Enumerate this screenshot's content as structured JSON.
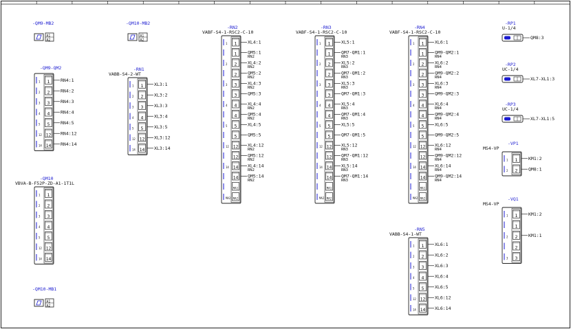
{
  "frame": {
    "ruler_count": 16
  },
  "colors": {
    "tag": "#1a1ad0",
    "line": "#222222",
    "rail": "#1a1ad0",
    "cap": "#c8c8c8"
  },
  "devices": [
    {
      "id": "qm9-mb2",
      "kind": "coil",
      "tag": "-QM9-MB2",
      "subtitle": "",
      "pins": [
        "A1",
        "A2"
      ]
    },
    {
      "id": "qm10-mb2",
      "kind": "coil",
      "tag": "-QM10-MB2",
      "subtitle": "",
      "pins": [
        "A1",
        "A2"
      ]
    },
    {
      "id": "qm10-mb1",
      "kind": "coil",
      "tag": "-QM10-MB1",
      "subtitle": "",
      "pins": [
        "A1",
        "A2"
      ]
    },
    {
      "id": "qm9-qm2",
      "kind": "strip",
      "tag": "-QM9-QM2",
      "subtitle": "",
      "rows": [
        {
          "pin": "1",
          "left": "1",
          "right": [
            "RN4:1"
          ]
        },
        {
          "pin": "2",
          "left": "2",
          "right": [
            "RN4:2"
          ]
        },
        {
          "pin": "3",
          "left": "3",
          "right": [
            "RN4:3"
          ]
        },
        {
          "pin": "4",
          "left": "4",
          "right": [
            "RN4:4"
          ]
        },
        {
          "pin": "5",
          "left": "5",
          "right": [
            "RN4:5"
          ]
        },
        {
          "pin": "12",
          "left": "12",
          "right": [
            "RN4:12"
          ]
        },
        {
          "pin": "14",
          "left": "14",
          "right": [
            "RN4:14"
          ]
        }
      ]
    },
    {
      "id": "qm10",
      "kind": "strip",
      "tag": "-QM10",
      "subtitle": "VBVA-B-F52P-ZD-A1-1T1L",
      "rows": [
        {
          "pin": "1",
          "left": "1",
          "right": []
        },
        {
          "pin": "2",
          "left": "2",
          "right": []
        },
        {
          "pin": "3",
          "left": "3",
          "right": []
        },
        {
          "pin": "4",
          "left": "4",
          "right": []
        },
        {
          "pin": "5",
          "left": "5",
          "right": []
        },
        {
          "pin": "12",
          "left": "12",
          "right": []
        },
        {
          "pin": "14",
          "left": "14",
          "right": []
        }
      ]
    },
    {
      "id": "rn1",
      "kind": "strip",
      "tag": "-RN1",
      "subtitle": "VABB-S4-2-WT",
      "rows": [
        {
          "pin": "1",
          "left": "1",
          "right": [
            "XL3:1"
          ]
        },
        {
          "pin": "2",
          "left": "2",
          "right": [
            "XL3:2"
          ]
        },
        {
          "pin": "3",
          "left": "3",
          "right": [
            "XL3:3"
          ]
        },
        {
          "pin": "4",
          "left": "4",
          "right": [
            "XL3:4"
          ]
        },
        {
          "pin": "5",
          "left": "5",
          "right": [
            "XL3:5"
          ]
        },
        {
          "pin": "12",
          "left": "12",
          "right": [
            "XL3:12"
          ]
        },
        {
          "pin": "14",
          "left": "14",
          "right": [
            "XL3:14"
          ]
        }
      ]
    },
    {
      "id": "rn2",
      "kind": "strip",
      "tag": "-RN2",
      "subtitle": "VABF-S4-1-RSC2-C-10",
      "rows": [
        {
          "pin": "1",
          "left": "1",
          "right": [
            "XL4:1"
          ]
        },
        {
          "pin": "1",
          "left": "",
          "right": [
            "QM5:1",
            "RN2"
          ]
        },
        {
          "pin": "2",
          "left": "2",
          "right": [
            "XL4:2",
            "RN2"
          ]
        },
        {
          "pin": "2",
          "left": "",
          "right": [
            "QM5:2",
            "RN2"
          ]
        },
        {
          "pin": "3",
          "left": "3",
          "right": [
            "XL4:3",
            "RN2"
          ]
        },
        {
          "pin": "3",
          "left": "",
          "right": [
            "QM5:3"
          ]
        },
        {
          "pin": "4",
          "left": "4",
          "right": [
            "XL4:4",
            "RN2"
          ]
        },
        {
          "pin": "4",
          "left": "",
          "right": [
            "QM5:4",
            "RN2"
          ]
        },
        {
          "pin": "5",
          "left": "5",
          "right": [
            "XL4:5"
          ]
        },
        {
          "pin": "5",
          "left": "",
          "right": [
            "QM5:5"
          ]
        },
        {
          "pin": "12",
          "left": "12",
          "right": [
            "XL4:12",
            "RN2"
          ]
        },
        {
          "pin": "12",
          "left": "",
          "right": [
            "QM5:12",
            "RN2"
          ]
        },
        {
          "pin": "14",
          "left": "14",
          "right": [
            "XL4:14",
            "RN2"
          ]
        },
        {
          "pin": "14",
          "left": "",
          "right": [
            "QM5:14",
            "RN2"
          ]
        },
        {
          "pin": "MA1",
          "left": "",
          "right": []
        },
        {
          "pin": "MA2",
          "left": "MA2",
          "right": []
        }
      ]
    },
    {
      "id": "rn3",
      "kind": "strip",
      "tag": "-RN3",
      "subtitle": "VABF-S4-1-RSC2-C-10",
      "rows": [
        {
          "pin": "1",
          "left": "1",
          "right": [
            "XL5:1"
          ]
        },
        {
          "pin": "1",
          "left": "",
          "right": [
            "QM7-QM1:1",
            "RN3"
          ]
        },
        {
          "pin": "2",
          "left": "2",
          "right": [
            "XL5:2",
            "RN3"
          ]
        },
        {
          "pin": "2",
          "left": "",
          "right": [
            "QM7-QM1:2",
            "RN3"
          ]
        },
        {
          "pin": "3",
          "left": "3",
          "right": [
            "XL5:3",
            "RN3"
          ]
        },
        {
          "pin": "3",
          "left": "",
          "right": [
            "QM7-QM1:3"
          ]
        },
        {
          "pin": "4",
          "left": "4",
          "right": [
            "XL5:4",
            "RN3"
          ]
        },
        {
          "pin": "4",
          "left": "",
          "right": [
            "QM7-QM1:4",
            "RN3"
          ]
        },
        {
          "pin": "5",
          "left": "5",
          "right": [
            "XL5:5"
          ]
        },
        {
          "pin": "5",
          "left": "",
          "right": [
            "QM7-QM1:5"
          ]
        },
        {
          "pin": "12",
          "left": "12",
          "right": [
            "XL5:12",
            "RN3"
          ]
        },
        {
          "pin": "12",
          "left": "",
          "right": [
            "QM7-QM1:12",
            "RN3"
          ]
        },
        {
          "pin": "14",
          "left": "14",
          "right": [
            "XL5:14",
            "RN3"
          ]
        },
        {
          "pin": "14",
          "left": "",
          "right": [
            "QM7-QM1:14",
            "RN3"
          ]
        },
        {
          "pin": "MA1",
          "left": "",
          "right": []
        },
        {
          "pin": "MA2",
          "left": "MA2",
          "right": []
        }
      ]
    },
    {
      "id": "rn4",
      "kind": "strip",
      "tag": "-RN4",
      "subtitle": "VABF-S4-1-RSC2-C-10",
      "rows": [
        {
          "pin": "1",
          "left": "1",
          "right": [
            "XL6:1"
          ]
        },
        {
          "pin": "1",
          "left": "",
          "right": [
            "QM9-QM2:1",
            "RN4"
          ]
        },
        {
          "pin": "2",
          "left": "2",
          "right": [
            "XL6:2",
            "RN4"
          ]
        },
        {
          "pin": "2",
          "left": "",
          "right": [
            "QM9-QM2:2",
            "RN4"
          ]
        },
        {
          "pin": "3",
          "left": "3",
          "right": [
            "XL6:3",
            "RN4"
          ]
        },
        {
          "pin": "3",
          "left": "",
          "right": [
            "QM9-QM2:3"
          ]
        },
        {
          "pin": "4",
          "left": "4",
          "right": [
            "XL6:4",
            "RN4"
          ]
        },
        {
          "pin": "4",
          "left": "",
          "right": [
            "QM9-QM2:4",
            "RN4"
          ]
        },
        {
          "pin": "5",
          "left": "5",
          "right": [
            "XL6:5"
          ]
        },
        {
          "pin": "5",
          "left": "",
          "right": [
            "QM9-QM2:5"
          ]
        },
        {
          "pin": "12",
          "left": "12",
          "right": [
            "XL6:12",
            "RN4"
          ]
        },
        {
          "pin": "12",
          "left": "",
          "right": [
            "QM9-QM2:12",
            "RN4"
          ]
        },
        {
          "pin": "14",
          "left": "14",
          "right": [
            "XL6:14",
            "RN4"
          ]
        },
        {
          "pin": "14",
          "left": "",
          "right": [
            "QM9-QM2:14",
            "RN4"
          ]
        },
        {
          "pin": "MA1",
          "left": "",
          "right": []
        },
        {
          "pin": "MA2",
          "left": "MA2",
          "right": []
        }
      ]
    },
    {
      "id": "rn5",
      "kind": "strip",
      "tag": "-RN5",
      "subtitle": "VABB-S4-1-WT",
      "rows": [
        {
          "pin": "1",
          "left": "1",
          "right": [
            "XL6:1"
          ]
        },
        {
          "pin": "2",
          "left": "2",
          "right": [
            "XL6:2"
          ]
        },
        {
          "pin": "3",
          "left": "3",
          "right": [
            "XL6:3"
          ]
        },
        {
          "pin": "4",
          "left": "4",
          "right": [
            "XL6:4"
          ]
        },
        {
          "pin": "5",
          "left": "5",
          "right": [
            "XL6:5"
          ]
        },
        {
          "pin": "12",
          "left": "12",
          "right": [
            "XL6:12"
          ]
        },
        {
          "pin": "14",
          "left": "14",
          "right": [
            "XL6:14"
          ]
        }
      ]
    },
    {
      "id": "rp1",
      "kind": "sensor",
      "tag": "-RP1",
      "subtitle": "U-1/4",
      "right": [
        "QM8:3"
      ]
    },
    {
      "id": "rp2",
      "kind": "sensor",
      "tag": "-RP2",
      "subtitle": "UC-1/4",
      "right": [
        "XL7-XL1:3"
      ]
    },
    {
      "id": "rp3",
      "kind": "sensor",
      "tag": "-RP3",
      "subtitle": "UC-1/4",
      "right": [
        "XL7-XL1:5"
      ]
    },
    {
      "id": "vp1",
      "kind": "strip",
      "tag": "-VP1",
      "subtitle": "MS4-VP",
      "rows": [
        {
          "pin": "1",
          "left": "1",
          "right": [
            "KM1:2"
          ]
        },
        {
          "pin": "2",
          "left": "2",
          "right": [
            "QM8:1"
          ]
        }
      ]
    },
    {
      "id": "vq1",
      "kind": "strip",
      "tag": "-VQ1",
      "subtitle": "MS4-VP",
      "rows": [
        {
          "pin": "1",
          "left": "1",
          "right": [
            "KM1:2"
          ]
        },
        {
          "pin": "1",
          "left": "",
          "right": []
        },
        {
          "pin": "2",
          "left": "2",
          "right": [
            "KM1:1"
          ]
        },
        {
          "pin": "2",
          "left": "",
          "right": []
        },
        {
          "pin": "3",
          "left": "3",
          "right": []
        }
      ]
    }
  ]
}
